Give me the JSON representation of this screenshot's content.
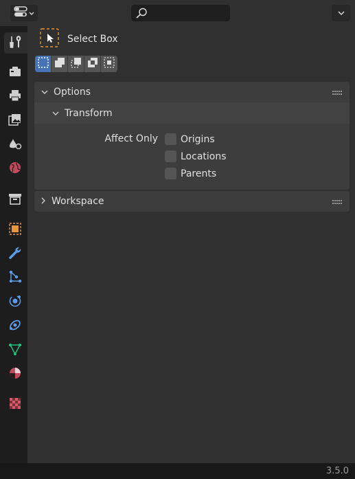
{
  "header": {
    "editor_type_icon": "properties-editor-icon",
    "search": {
      "value": "",
      "placeholder": ""
    },
    "dropdown_icon": "chevron-down-icon"
  },
  "tabs": [
    {
      "name": "tool",
      "icon": "tool-wrench-screwdriver-icon",
      "color": "#cfcfcf",
      "active": true
    },
    {
      "name": "render",
      "icon": "render-camera-back-icon",
      "color": "#cfcfcf"
    },
    {
      "name": "output",
      "icon": "output-printer-icon",
      "color": "#cfcfcf"
    },
    {
      "name": "view-layer",
      "icon": "view-layer-images-icon",
      "color": "#cfcfcf"
    },
    {
      "name": "scene",
      "icon": "scene-shapes-icon",
      "color": "#cfcfcf"
    },
    {
      "name": "world",
      "icon": "world-globe-icon",
      "color": "#d35b6a"
    },
    {
      "name": "collection",
      "icon": "collection-box-icon",
      "color": "#cfcfcf"
    },
    {
      "name": "object",
      "icon": "object-square-icon",
      "color": "#e8953c"
    },
    {
      "name": "modifiers",
      "icon": "modifier-wrench-icon",
      "color": "#5c9ce6"
    },
    {
      "name": "particles",
      "icon": "particles-icon",
      "color": "#5c9ce6"
    },
    {
      "name": "physics",
      "icon": "physics-orbit-icon",
      "color": "#5c9ce6"
    },
    {
      "name": "constraints",
      "icon": "object-constraint-icon",
      "color": "#5c9ce6"
    },
    {
      "name": "data",
      "icon": "mesh-data-triangle-icon",
      "color": "#1cc47c"
    },
    {
      "name": "material",
      "icon": "material-sphere-icon",
      "color": "#d35b6a"
    },
    {
      "name": "texture",
      "icon": "texture-checker-icon",
      "color": "#d35b6a"
    }
  ],
  "tool": {
    "icon": "select-box-cursor-icon",
    "label": "Select Box",
    "modes": [
      {
        "name": "set",
        "icon": "select-set-icon",
        "active": true
      },
      {
        "name": "extend",
        "icon": "select-extend-icon"
      },
      {
        "name": "subtract",
        "icon": "select-subtract-icon"
      },
      {
        "name": "invert",
        "icon": "select-difference-icon"
      },
      {
        "name": "intersect",
        "icon": "select-intersect-icon"
      }
    ]
  },
  "options_panel": {
    "title": "Options",
    "transform": {
      "title": "Transform",
      "affect_only_label": "Affect Only",
      "checks": [
        {
          "label": "Origins",
          "checked": false
        },
        {
          "label": "Locations",
          "checked": false
        },
        {
          "label": "Parents",
          "checked": false
        }
      ]
    }
  },
  "workspace_panel": {
    "title": "Workspace"
  },
  "status": {
    "version": "3.5.0"
  },
  "colors": {
    "accent": "#4772b3",
    "panel": "#3d3d3d",
    "background": "#303030"
  }
}
